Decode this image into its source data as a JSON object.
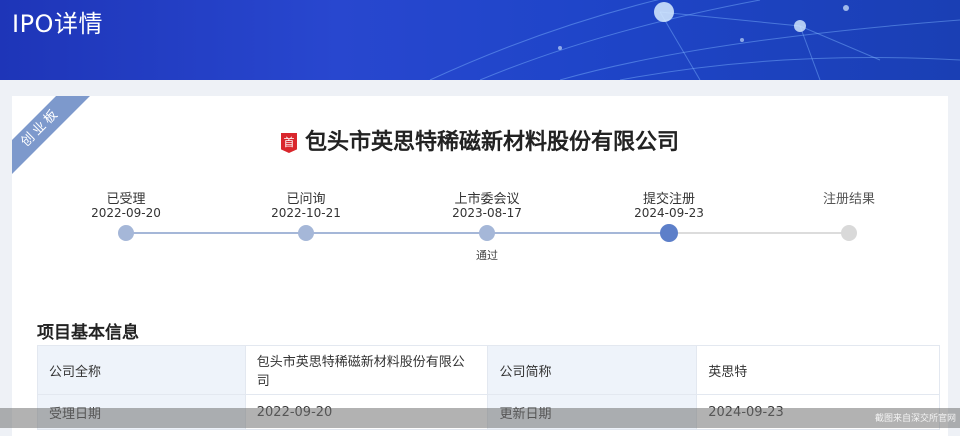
{
  "header": {
    "title": "IPO详情"
  },
  "board_ribbon": "创业板",
  "company": {
    "name": "包头市英思特稀磁新材料股份有限公司",
    "badge": "首"
  },
  "timeline": [
    {
      "label": "已受理",
      "date": "2022-09-20",
      "note": "",
      "state": "done"
    },
    {
      "label": "已问询",
      "date": "2022-10-21",
      "note": "",
      "state": "done"
    },
    {
      "label": "上市委会议",
      "date": "2023-08-17",
      "note": "通过",
      "state": "done"
    },
    {
      "label": "提交注册",
      "date": "2024-09-23",
      "note": "",
      "state": "current"
    },
    {
      "label": "注册结果",
      "date": "",
      "note": "",
      "state": "pending"
    }
  ],
  "section": {
    "title": "项目基本信息"
  },
  "info": {
    "rows": [
      [
        {
          "label": "公司全称",
          "value": "包头市英思特稀磁新材料股份有限公司"
        },
        {
          "label": "公司简称",
          "value": "英思特"
        }
      ],
      [
        {
          "label": "受理日期",
          "value": "2022-09-20"
        },
        {
          "label": "更新日期",
          "value": "2024-09-23"
        }
      ]
    ]
  },
  "watermark": "截图来自深交所官网",
  "colors": {
    "banner": "#2847cf",
    "dot_done": "#a5b7d8",
    "dot_current": "#5d7fc9",
    "dot_pending": "#d9d9d9",
    "ribbon": "#7d99cc",
    "badge": "#d9262c"
  }
}
